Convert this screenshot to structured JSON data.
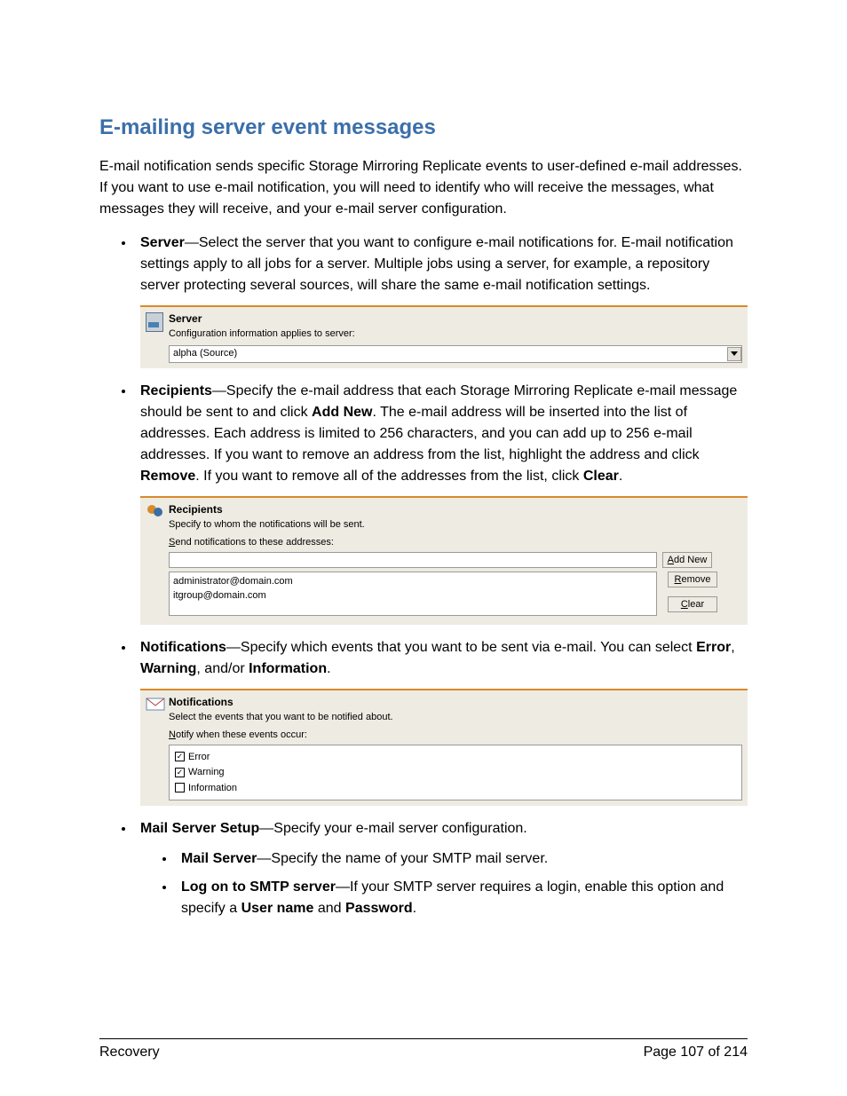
{
  "heading": "E-mailing server event messages",
  "intro": "E-mail notification sends specific Storage Mirroring Replicate events to user-defined e-mail addresses. If you want to use e-mail notification, you will need to identify who will receive the messages, what messages they will receive, and your e-mail server configuration.",
  "bullets": {
    "server": {
      "label": "Server",
      "text": "—Select the server that you want to configure e-mail notifications for. E-mail notification settings apply to all jobs for a server. Multiple jobs using a server, for example, a repository server protecting several sources, will share the same e-mail notification settings."
    },
    "recipients": {
      "label": "Recipients",
      "text_pre": "—Specify the e-mail address that each Storage Mirroring Replicate e-mail message should be sent to and click ",
      "add_new": "Add New",
      "text_mid": ". The e-mail address will be inserted into the list of addresses. Each address is limited to 256 characters, and you can add up to 256 e-mail addresses. If you want to remove an address from the list, highlight the address and click ",
      "remove": "Remove",
      "text_mid2": ". If you want to remove all of the addresses from the list, click ",
      "clear": "Clear",
      "text_end": "."
    },
    "notifications": {
      "label": "Notifications",
      "text_pre": "—Specify which events that you want to be sent via e-mail. You can select ",
      "error": "Error",
      "sep1": ", ",
      "warning": "Warning",
      "sep2": ", and/or ",
      "information": "Information",
      "text_end": "."
    },
    "mail_setup": {
      "label": "Mail Server Setup",
      "text": "—Specify your e-mail server configuration.",
      "sub": [
        {
          "label": "Mail Server",
          "text": "—Specify the name of your SMTP mail server."
        },
        {
          "label": "Log on to SMTP server",
          "text_pre": "—If your SMTP server requires a login, enable this option and specify a ",
          "u": "User name",
          "and": " and ",
          "p": "Password",
          "end": "."
        }
      ]
    }
  },
  "panel_server": {
    "title": "Server",
    "sub": "Configuration information applies to server:",
    "value": "alpha (Source)"
  },
  "panel_recipients": {
    "title": "Recipients",
    "sub": "Specify to whom the notifications will be sent.",
    "label_first": "S",
    "label_rest": "end notifications to these addresses:",
    "addresses": [
      "administrator@domain.com",
      "itgroup@domain.com"
    ],
    "btn_add_first": "A",
    "btn_add_rest": "dd New",
    "btn_remove_first": "R",
    "btn_remove_rest": "emove",
    "btn_clear_first": "C",
    "btn_clear_rest": "lear"
  },
  "panel_notifications": {
    "title": "Notifications",
    "sub": "Select the events that you want to be notified about.",
    "label_first": "N",
    "label_rest": "otify when these events occur:",
    "options": [
      {
        "label": "Error",
        "checked": true
      },
      {
        "label": "Warning",
        "checked": true
      },
      {
        "label": "Information",
        "checked": false
      }
    ]
  },
  "footer": {
    "left": "Recovery",
    "right": "Page 107 of 214"
  }
}
